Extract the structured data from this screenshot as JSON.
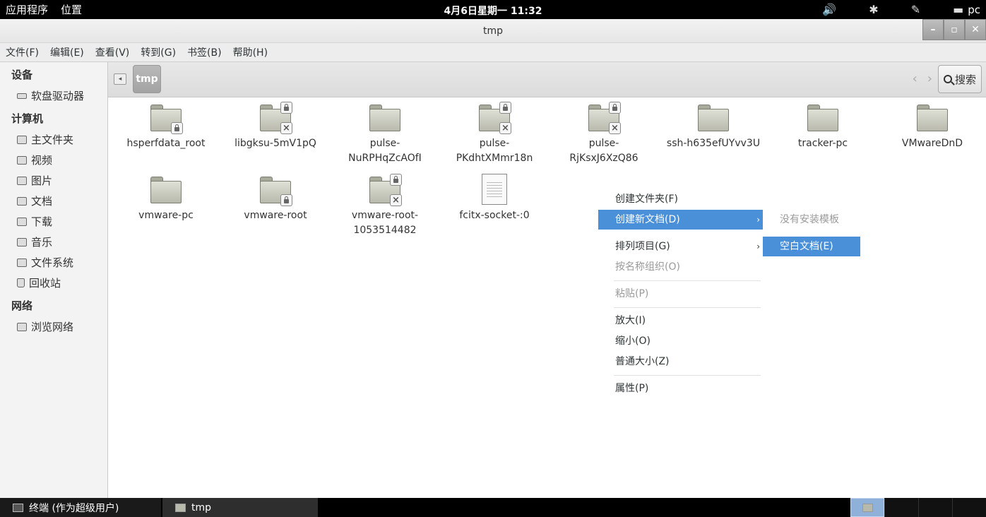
{
  "top_panel": {
    "apps": "应用程序",
    "places": "位置",
    "clock": "4月6日星期一 11:32",
    "user": "pc",
    "volume_icon": "🔊",
    "bluetooth_icon": "✱",
    "chat_icon": "▬"
  },
  "window": {
    "title": "tmp",
    "minimize": "–",
    "maximize": "▫",
    "close": "✕"
  },
  "menubar": [
    "文件(F)",
    "编辑(E)",
    "查看(V)",
    "转到(G)",
    "书签(B)",
    "帮助(H)"
  ],
  "sidebar": {
    "devices_header": "设备",
    "devices": [
      "软盘驱动器"
    ],
    "computer_header": "计算机",
    "computer": [
      "主文件夹",
      "视频",
      "图片",
      "文档",
      "下载",
      "音乐",
      "文件系统",
      "回收站"
    ],
    "network_header": "网络",
    "network": [
      "浏览网络"
    ]
  },
  "toolbar": {
    "crumb": "tmp",
    "search": "搜索",
    "back_arrow": "‹",
    "forward_arrow": "›"
  },
  "files": [
    {
      "name": "hsperfdata_root",
      "type": "folder",
      "emblems": [
        "lock"
      ]
    },
    {
      "name": "libgksu-5mV1pQ",
      "type": "folder",
      "emblems": [
        "lock",
        "x"
      ]
    },
    {
      "name": "pulse-NuRPHqZcAOfI",
      "line1": "pulse-",
      "line2": "NuRPHqZcAOfI",
      "type": "folder",
      "emblems": []
    },
    {
      "name": "pulse-PKdhtXMmr18n",
      "line1": "pulse-",
      "line2": "PKdhtXMmr18n",
      "type": "folder",
      "emblems": [
        "lock",
        "x"
      ]
    },
    {
      "name": "pulse-RjKsxJ6XzQ86",
      "line1": "pulse-",
      "line2": "RjKsxJ6XzQ86",
      "type": "folder",
      "emblems": [
        "lock",
        "x"
      ]
    },
    {
      "name": "ssh-h635efUYvv3U",
      "type": "folder",
      "emblems": []
    },
    {
      "name": "tracker-pc",
      "type": "folder",
      "emblems": []
    },
    {
      "name": "VMwareDnD",
      "type": "folder",
      "emblems": []
    },
    {
      "name": "vmware-pc",
      "type": "folder",
      "emblems": []
    },
    {
      "name": "vmware-root",
      "type": "folder",
      "emblems": [
        "lock"
      ]
    },
    {
      "name": "vmware-root-1053514482",
      "line1": "vmware-root-",
      "line2": "1053514482",
      "type": "folder",
      "emblems": [
        "lock",
        "x"
      ]
    },
    {
      "name": "fcitx-socket-:0",
      "type": "document",
      "emblems": []
    }
  ],
  "context_menu": {
    "create_folder": "创建文件夹(F)",
    "create_document": "创建新文档(D)",
    "arrange": "排列项目(G)",
    "organize_by_name": "按名称组织(O)",
    "paste": "粘贴(P)",
    "zoom_in": "放大(I)",
    "zoom_out": "缩小(O)",
    "normal_size": "普通大小(Z)",
    "properties": "属性(P)",
    "submenu_arrow": "›"
  },
  "submenu": {
    "no_templates": "没有安装模板",
    "empty_document": "空白文档(E)"
  },
  "taskbar": {
    "terminal": "终端 (作为超级用户)",
    "tmp": "tmp"
  },
  "colors": {
    "selection": "#4a90d9",
    "panel": "#000000"
  }
}
